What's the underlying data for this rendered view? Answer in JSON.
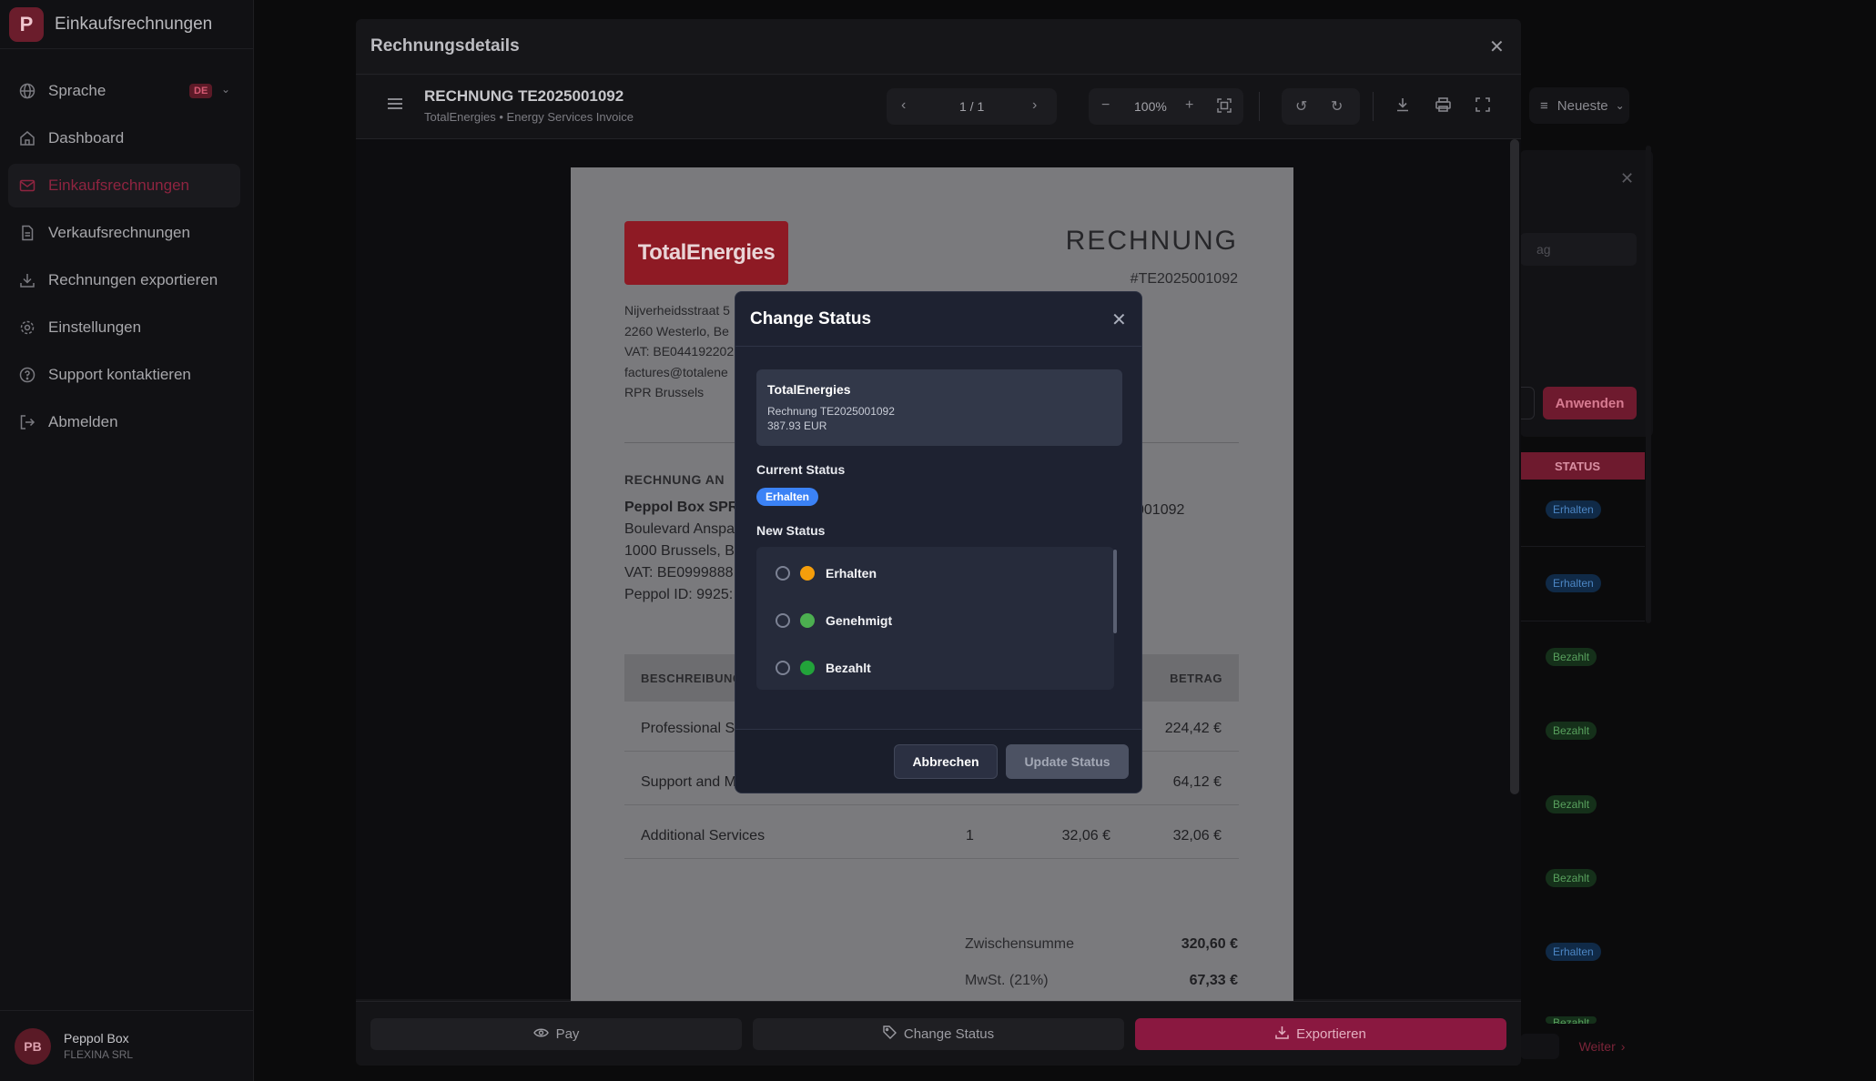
{
  "app": {
    "logo_letter": "P",
    "title": "Einkaufsrechnungen"
  },
  "sidebar": {
    "language": {
      "label": "Sprache",
      "badge": "DE"
    },
    "items": [
      {
        "label": "Dashboard",
        "icon": "home-icon"
      },
      {
        "label": "Einkaufsrechnungen",
        "icon": "mail-icon",
        "active": true
      },
      {
        "label": "Verkaufsrechnungen",
        "icon": "file-icon"
      },
      {
        "label": "Rechnungen exportieren",
        "icon": "download-icon"
      },
      {
        "label": "Einstellungen",
        "icon": "gear-icon"
      },
      {
        "label": "Support kontaktieren",
        "icon": "help-circle-icon"
      },
      {
        "label": "Abmelden",
        "icon": "logout-icon"
      }
    ],
    "user": {
      "initials": "PB",
      "name": "Peppol Box",
      "org": "FLEXINA SRL"
    }
  },
  "background_list": {
    "sort_label": "Neueste",
    "filter_placeholder": "ag",
    "apply_label": "Anwenden",
    "status_header": "STATUS",
    "statuses": [
      "Erhalten",
      "Erhalten",
      "Bezahlt",
      "Bezahlt",
      "Bezahlt",
      "Bezahlt",
      "Erhalten",
      "Bezahlt"
    ],
    "next_label": "Weiter"
  },
  "invoice_modal": {
    "title": "Rechnungsdetails",
    "doc_title": "RECHNUNG TE2025001092",
    "doc_subtitle": "TotalEnergies • Energy Services Invoice",
    "page_indicator": "1 / 1",
    "zoom": "100%",
    "paper": {
      "logo_text": "TotalEnergies",
      "heading": "RECHNUNG",
      "number": "#TE2025001092",
      "sender_lines": [
        "Nijverheidsstraat 5",
        "2260 Westerlo, Be",
        "VAT: BE044192202",
        "factures@totalene",
        "RPR Brussels"
      ],
      "bill_to_label": "RECHNUNG AN",
      "bill_to_name": "Peppol Box SPRL",
      "bill_to_lines": [
        "Boulevard Anspa",
        "1000 Brussels, Be",
        "VAT: BE0999888",
        "Peppol ID: 9925:"
      ],
      "side_ref": "001092",
      "table_headers": {
        "description": "BESCHREIBUNG",
        "amount": "BETRAG"
      },
      "rows": [
        {
          "description": "Professional S",
          "qty": "",
          "price": "",
          "amount": "224,42 €"
        },
        {
          "description": "Support and M",
          "qty": "",
          "price": "",
          "amount": "64,12 €"
        },
        {
          "description": "Additional Services",
          "qty": "1",
          "price": "32,06 €",
          "amount": "32,06 €"
        }
      ],
      "subtotal_label": "Zwischensumme",
      "subtotal_value": "320,60 €",
      "vat_label": "MwSt. (21%)",
      "vat_value": "67,33 €"
    },
    "actions": {
      "pay": "Pay",
      "change_status": "Change Status",
      "export": "Exportieren"
    }
  },
  "status_dialog": {
    "title": "Change Status",
    "invoice_name": "TotalEnergies",
    "invoice_ref": "Rechnung TE2025001092",
    "invoice_amount": "387.93 EUR",
    "current_label": "Current Status",
    "current_value": "Erhalten",
    "new_label": "New Status",
    "options": [
      {
        "label": "Erhalten",
        "color": "#f59e0b"
      },
      {
        "label": "Genehmigt",
        "color": "#4caf50"
      },
      {
        "label": "Bezahlt",
        "color": "#22a33a"
      }
    ],
    "cancel_label": "Abbrechen",
    "update_label": "Update Status"
  }
}
